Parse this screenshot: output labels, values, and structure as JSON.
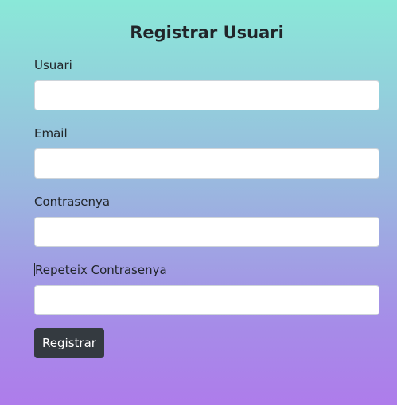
{
  "form": {
    "title": "Registrar Usuari",
    "fields": [
      {
        "label": "Usuari",
        "value": ""
      },
      {
        "label": "Email",
        "value": ""
      },
      {
        "label": "Contrasenya",
        "value": ""
      },
      {
        "label": "Repeteix Contrasenya",
        "value": ""
      }
    ],
    "submit_label": "Registrar"
  },
  "colors": {
    "gradient_top": "#8ae8d8",
    "gradient_bottom": "#ae7ceb",
    "button_bg": "#343a40",
    "button_text": "#ffffff",
    "input_bg": "#ffffff",
    "input_border": "#ced4da"
  }
}
